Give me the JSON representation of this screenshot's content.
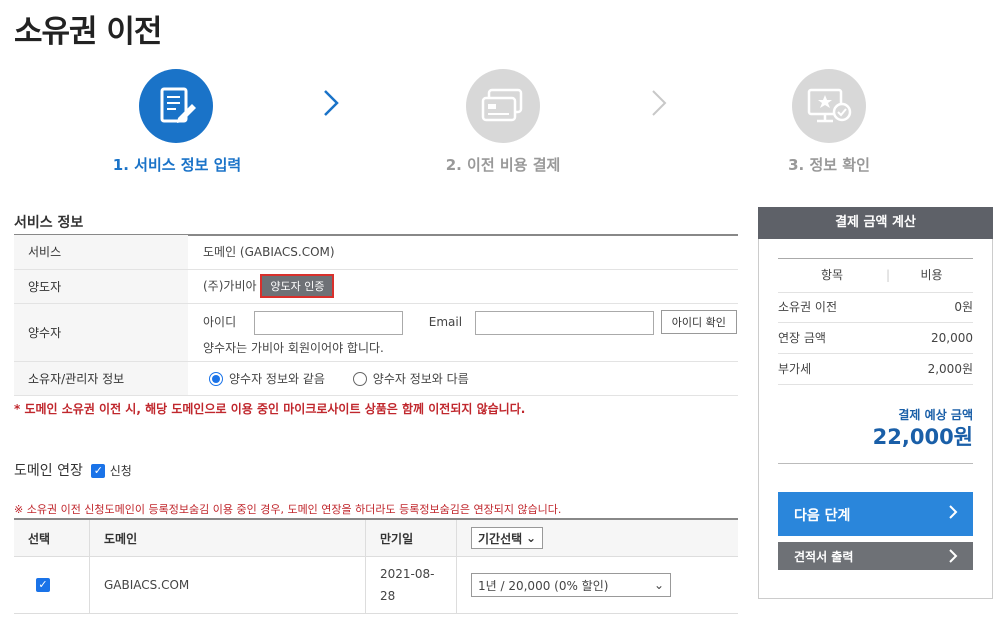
{
  "page": {
    "title": "소유권 이전"
  },
  "steps": [
    {
      "label": "1. 서비스 정보 입력",
      "active": true
    },
    {
      "label": "2. 이전 비용 결제",
      "active": false
    },
    {
      "label": "3. 정보 확인",
      "active": false
    }
  ],
  "service_info": {
    "section_title": "서비스 정보",
    "rows": {
      "service": {
        "label": "서비스",
        "value": "도메인 (GABIACS.COM)"
      },
      "transferor": {
        "label": "양도자",
        "value": "(주)가비아",
        "button": "양도자 인증"
      },
      "transferee": {
        "label": "양수자",
        "id_label": "아이디",
        "email_label": "Email",
        "check_button": "아이디 확인",
        "note": "양수자는 가비아 회원이어야 합니다.",
        "id_value": "",
        "email_value": ""
      },
      "owner_manager": {
        "label": "소유자/관리자 정보",
        "option_same": "양수자 정보와 같음",
        "option_diff": "양수자 정보와 다름",
        "selected": "same"
      }
    },
    "warning": "* 도메인 소유권 이전 시, 해당 도메인으로 이용 중인 마이크로사이트 상품은 함께 이전되지 않습니다."
  },
  "domain_extension": {
    "title": "도메인 연장",
    "apply_label": "신청",
    "apply_checked": true,
    "warning": "※ 소유권 이전 신청도메인이 등록정보숨김 이용 중인 경우, 도메인 연장을 하더라도 등록정보숨김은 연장되지 않습니다.",
    "columns": {
      "select": "선택",
      "domain": "도메인",
      "expiry": "만기일",
      "period": "기간선택"
    },
    "rows": [
      {
        "checked": true,
        "domain": "GABIACS.COM",
        "expiry_line1": "2021-08-",
        "expiry_line2": "28",
        "period": "1년 / 20,000 (0% 할인)"
      }
    ]
  },
  "payment": {
    "header": "결제 금액 계산",
    "col_item": "항목",
    "col_cost": "비용",
    "items": [
      {
        "name": "소유권 이전",
        "cost": "0원"
      },
      {
        "name": "연장 금액",
        "cost": "20,000"
      },
      {
        "name": "부가세",
        "cost": "2,000원"
      }
    ],
    "expected_label": "결제 예상 금액",
    "expected_total": "22,000원",
    "next_button": "다음 단계",
    "quote_button": "견적서 출력"
  },
  "colors": {
    "accent": "#2a86db",
    "step_active": "#1a73c8",
    "warning": "#c0272d",
    "panel_header": "#5e6168"
  },
  "icons": [
    "document-edit-icon",
    "credit-card-icon",
    "monitor-check-icon",
    "chevron-right-icon"
  ]
}
